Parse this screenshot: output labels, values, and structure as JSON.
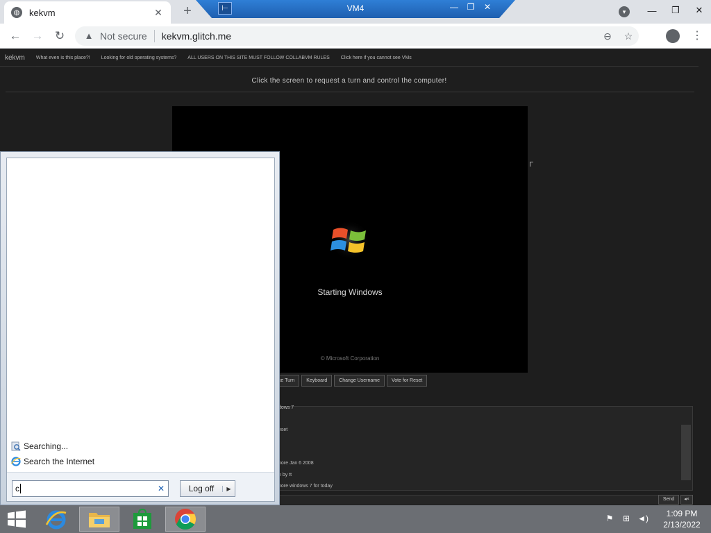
{
  "browser": {
    "tab_title": "kekvm",
    "new_tab_glyph": "+",
    "security_label": "Not secure",
    "url": "kekvm.glitch.me"
  },
  "vm_session": {
    "title": "VM4"
  },
  "page": {
    "nav": {
      "brand": "kekvm",
      "links": [
        "What even is this place?!",
        "Looking for old operating systems?",
        "ALL USERS ON THIS SITE MUST FOLLOW COLLABVM RULES",
        "Click here if you cannot see VMs"
      ]
    },
    "request_turn": "Click the screen to request a turn and control the computer!",
    "boot_text": "Starting Windows",
    "copyright": "© Microsoft Corporation",
    "buttons": [
      "ake Turn",
      "Keyboard",
      "Change Username",
      "Vote for Reset"
    ],
    "chat_lines": [
      "dows 7",
      "eset",
      "nore Jan 6 2008",
      "n by tt",
      "nore windows 7 for today"
    ],
    "send_label": "Send",
    "mute_glyph": "◂×"
  },
  "start_menu": {
    "results": [
      {
        "label": "Searching...",
        "icon": "search-progress-icon"
      },
      {
        "label": "Search the Internet",
        "icon": "internet-explorer-icon"
      }
    ],
    "search_value": "c",
    "log_off_label": "Log off"
  },
  "taskbar": {
    "apps": [
      "internet-explorer",
      "file-explorer",
      "store",
      "chrome"
    ],
    "time": "1:09 PM",
    "date": "2/13/2022"
  }
}
